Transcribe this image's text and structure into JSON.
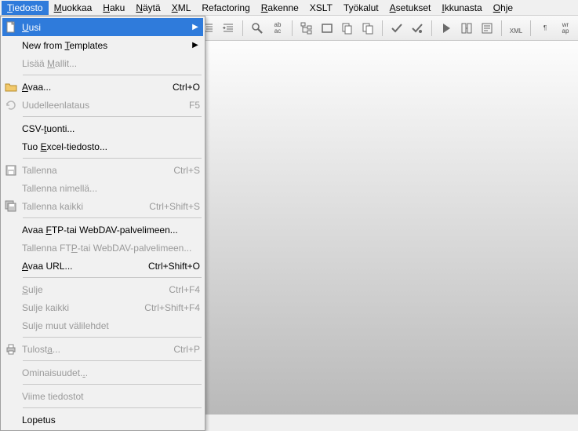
{
  "menubar": [
    {
      "label": "Tiedosto",
      "u": 0,
      "active": true
    },
    {
      "label": "Muokkaa",
      "u": 0
    },
    {
      "label": "Haku",
      "u": 0
    },
    {
      "label": "Näytä",
      "u": 0
    },
    {
      "label": "XML",
      "u": 0
    },
    {
      "label": "Refactoring",
      "u": -1
    },
    {
      "label": "Rakenne",
      "u": 0
    },
    {
      "label": "XSLT",
      "u": -1
    },
    {
      "label": "Työkalut",
      "u": -1
    },
    {
      "label": "Asetukset",
      "u": 0
    },
    {
      "label": "Ikkunasta",
      "u": 0
    },
    {
      "label": "Ohje",
      "u": 0
    }
  ],
  "dropdown": [
    {
      "type": "item",
      "icon": "doc-icon",
      "label": "Uusi",
      "u": 0,
      "sub": true,
      "hl": true
    },
    {
      "type": "item",
      "label": "New from Templates",
      "u": 9,
      "sub": true
    },
    {
      "type": "item",
      "label": "Lisää Mallit...",
      "u": 6,
      "disabled": true
    },
    {
      "type": "sep"
    },
    {
      "type": "item",
      "icon": "open-icon",
      "label": "Avaa...",
      "u": 0,
      "shortcut": "Ctrl+O"
    },
    {
      "type": "item",
      "icon": "reload-icon",
      "label": "Uudelleenlataus",
      "shortcut": "F5",
      "disabled": true
    },
    {
      "type": "sep"
    },
    {
      "type": "item",
      "label": "CSV-tuonti...",
      "u": 4
    },
    {
      "type": "item",
      "label": "Tuo Excel-tiedosto...",
      "u": 4
    },
    {
      "type": "sep"
    },
    {
      "type": "item",
      "icon": "save-icon",
      "label": "Tallenna",
      "shortcut": "Ctrl+S",
      "disabled": true
    },
    {
      "type": "item",
      "label": "Tallenna nimellä...",
      "disabled": true
    },
    {
      "type": "item",
      "icon": "save-all-icon",
      "label": "Tallenna kaikki",
      "shortcut": "Ctrl+Shift+S",
      "disabled": true
    },
    {
      "type": "sep"
    },
    {
      "type": "item",
      "label": "Avaa FTP-tai WebDAV-palvelimeen...",
      "u": 5
    },
    {
      "type": "item",
      "label": "Tallenna FTP-tai WebDAV-palvelimeen...",
      "u": 11,
      "disabled": true
    },
    {
      "type": "item",
      "label": "Avaa URL...",
      "u": 0,
      "shortcut": "Ctrl+Shift+O"
    },
    {
      "type": "sep"
    },
    {
      "type": "item",
      "label": "Sulje",
      "u": 0,
      "shortcut": "Ctrl+F4",
      "disabled": true
    },
    {
      "type": "item",
      "label": "Sulje kaikki",
      "shortcut": "Ctrl+Shift+F4",
      "disabled": true
    },
    {
      "type": "item",
      "label": "Sulje muut välilehdet",
      "disabled": true
    },
    {
      "type": "sep"
    },
    {
      "type": "item",
      "icon": "print-icon",
      "label": "Tulosta...",
      "u": 6,
      "shortcut": "Ctrl+P",
      "disabled": true
    },
    {
      "type": "sep"
    },
    {
      "type": "item",
      "label": "Ominaisuudet...",
      "u": 13,
      "disabled": true
    },
    {
      "type": "sep"
    },
    {
      "type": "item",
      "label": "Viime tiedostot",
      "disabled": true
    },
    {
      "type": "sep"
    },
    {
      "type": "item",
      "label": "Lopetus"
    }
  ],
  "toolbar_groups": [
    {
      "items": [
        {
          "name": "indent-left-icon"
        },
        {
          "name": "indent-right-icon"
        }
      ]
    },
    {
      "items": [
        {
          "name": "find-icon"
        },
        {
          "name": "find-replace-icon",
          "txt": "ab\nac"
        }
      ]
    },
    {
      "items": [
        {
          "name": "tree-icon"
        },
        {
          "name": "box-icon"
        },
        {
          "name": "copy-icon"
        },
        {
          "name": "paste-icon"
        }
      ]
    },
    {
      "items": [
        {
          "name": "check-icon"
        },
        {
          "name": "check2-icon"
        }
      ]
    },
    {
      "items": [
        {
          "name": "play-icon"
        },
        {
          "name": "convert-icon"
        },
        {
          "name": "config-icon"
        }
      ]
    },
    {
      "items": [
        {
          "name": "xml-icon",
          "txt": "<?>\nXML"
        }
      ]
    },
    {
      "items": [
        {
          "name": "pilcrow-icon",
          "txt": "¶"
        },
        {
          "name": "wrap-icon",
          "txt": "wr\nap"
        }
      ]
    }
  ]
}
